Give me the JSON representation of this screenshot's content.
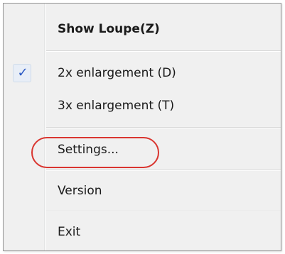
{
  "menu": {
    "items": [
      {
        "label": "Show Loupe(Z)",
        "bold": true,
        "checked": false
      },
      {
        "label": "2x enlargement (D)",
        "bold": false,
        "checked": true
      },
      {
        "label": "3x enlargement (T)",
        "bold": false,
        "checked": false
      },
      {
        "label": "Settings...",
        "bold": false,
        "checked": false,
        "annotated": true
      },
      {
        "label": "Version",
        "bold": false,
        "checked": false
      },
      {
        "label": "Exit",
        "bold": false,
        "checked": false
      }
    ],
    "check_glyph": "✓",
    "check_icon": "checkmark-icon"
  },
  "colors": {
    "menu_bg": "#f0f0f0",
    "check_color": "#2a58c4",
    "annotation": "#d9352f"
  }
}
